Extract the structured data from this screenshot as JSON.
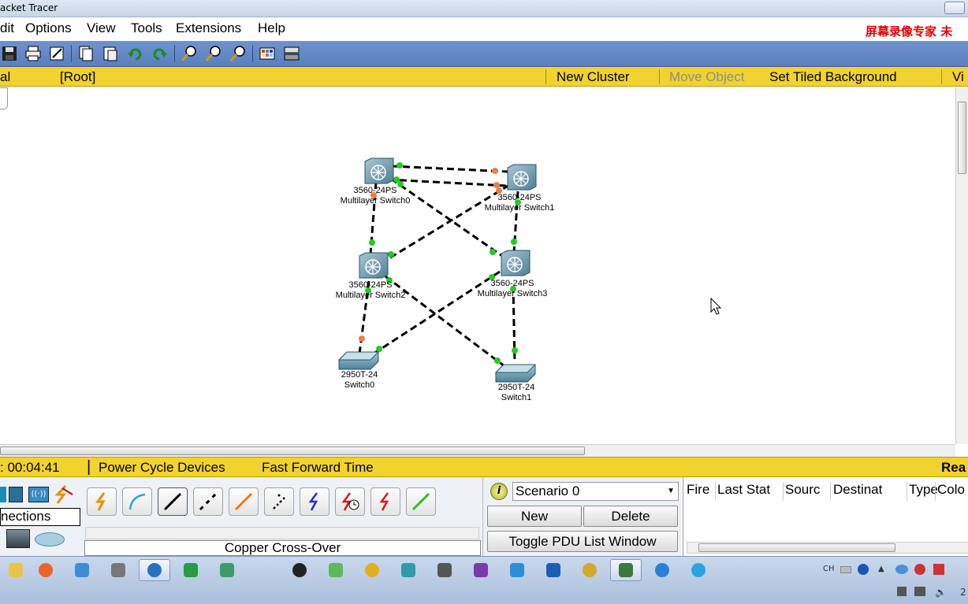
{
  "window": {
    "title": "acket Tracer"
  },
  "menu": {
    "items": [
      "dit",
      "Options",
      "View",
      "Tools",
      "Extensions",
      "Help"
    ],
    "watermark": "屏幕录像专家 未"
  },
  "logical_bar": {
    "mode": "al",
    "root": "[Root]",
    "new_cluster": "New Cluster",
    "move_object": "Move Object",
    "set_tiled_background": "Set Tiled Background",
    "viewport": "Vi"
  },
  "devices": [
    {
      "model": "3560-24PS",
      "name": "Multilayer Switch0"
    },
    {
      "model": "3560-24PS",
      "name": "Multilayer Switch1"
    },
    {
      "model": "3560-24PS",
      "name": "Multilayer Switch2"
    },
    {
      "model": "3560-24PS",
      "name": "Multilayer Switch3"
    },
    {
      "model": "2950T-24",
      "name": "Switch0"
    },
    {
      "model": "2950T-24",
      "name": "Switch1"
    }
  ],
  "colors": {
    "link_up": "#22cc22",
    "link_blocked": "#e8824a",
    "logic_bar": "#f2d22e",
    "toolbar": "#5a7fbf"
  },
  "time_bar": {
    "time": ": 00:04:41",
    "power_cycle": "Power Cycle Devices",
    "fast_forward": "Fast Forward Time",
    "realtime": "Rea"
  },
  "device_panel": {
    "category_label": "nections",
    "selected_cable": "Copper Cross-Over",
    "cables": [
      "automatic-icon",
      "console-icon",
      "copper-straight-icon",
      "copper-cross-icon",
      "fiber-icon",
      "phone-icon",
      "coaxial-icon",
      "serial-dce-icon",
      "serial-dte-icon",
      "octal-icon"
    ]
  },
  "scenario": {
    "selected": "Scenario 0",
    "new_label": "New",
    "delete_label": "Delete",
    "toggle_label": "Toggle PDU List Window"
  },
  "pdu_table": {
    "columns": [
      "Fire",
      "Last Stat",
      "Sourc",
      "Destinat",
      "Type",
      "Colo"
    ]
  },
  "tray": {
    "lang": "CH",
    "clock": "2"
  }
}
